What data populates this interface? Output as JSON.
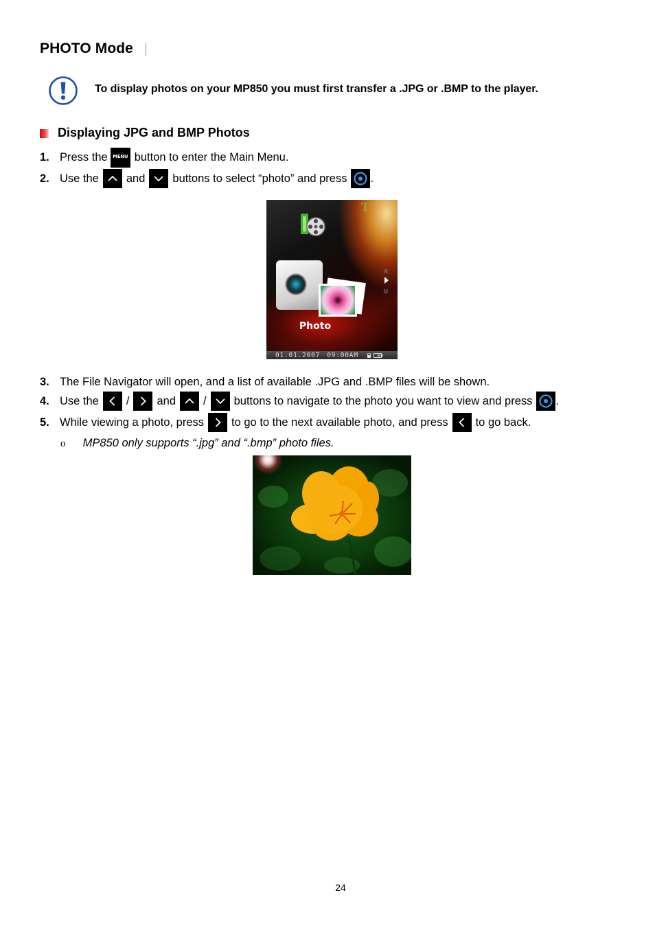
{
  "page": {
    "title": "PHOTO Mode",
    "notice": {
      "icon": "exclamation-circle-icon",
      "text": "To display photos on your MP850 you must first transfer a .JPG or .BMP to the player."
    },
    "section": {
      "title": "Displaying JPG and BMP Photos"
    },
    "steps": [
      {
        "number": "1.",
        "parts": [
          "Press the",
          "button to enter the Main Menu."
        ],
        "keys": [
          "menu-key"
        ],
        "menu_key_label": "MENU"
      },
      {
        "number": "2.",
        "parts": [
          "Use the",
          "and",
          "buttons to select “photo” and press",
          "."
        ],
        "keys": [
          "up-key",
          "down-key",
          "select-key"
        ]
      },
      {
        "number": "3.",
        "parts": [
          "The File Navigator will open, and a list of available .JPG and .BMP files will be shown."
        ]
      },
      {
        "number": "4.",
        "parts": [
          "Use the",
          "/",
          "and",
          "/",
          "buttons to navigate to the photo you want to view and press",
          "."
        ],
        "keys": [
          "left-key",
          "right-key",
          "up-key",
          "down-key",
          "select-key"
        ]
      },
      {
        "number": "5.",
        "parts": [
          "While viewing a photo, press",
          "to go to the next available photo, and press",
          "to go back."
        ],
        "keys": [
          "right-key",
          "left-key"
        ]
      }
    ],
    "note": {
      "bullet": "o",
      "text": "MP850 only supports “.jpg” and “.bmp” photo files."
    },
    "device_screen": {
      "menu_label": "Photo",
      "date": "01.01.2007",
      "time": "09:00AM",
      "status_icons": [
        "lock-icon",
        "battery-icon"
      ]
    },
    "sample_photo": {
      "subject": "orange-flower"
    },
    "page_number": "24"
  },
  "colors": {
    "notice_icon": "#1e4fa8",
    "section_bullet": "#e60000",
    "select_key_ring": "#3a9ae8",
    "key_background": "#000000"
  }
}
